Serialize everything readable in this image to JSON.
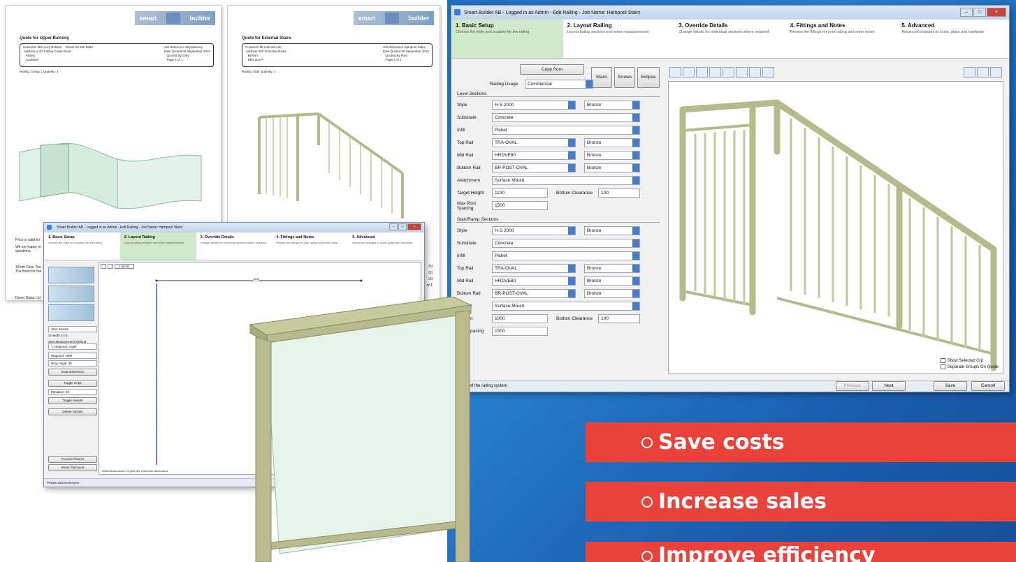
{
  "docs": [
    {
      "logo_left": "smart",
      "logo_right": "builder",
      "title": "Quote for Upper Balcony",
      "cust_col1": "Customer Mrs Lucy Rolston    Phone 09 555 9963\n Address 1-33 Jubilee Creek Road\n   Albany\n   Auckland",
      "cust_col2": "Job Reference Sky Balcony\nDate Quoted 09 September 2010\n   Quoted By Gary\n   Page 1 of 1",
      "meta": "Railing: Group 1     Quantity: 1",
      "price_note": "Price is valid for",
      "happy_note": "We are happy to",
      "questions": "questions.",
      "glass_note": "12mm Clear Tou",
      "finish_note": "The finish for the",
      "footer": "Demo Glass Ltd"
    },
    {
      "logo_left": "smart",
      "logo_right": "builder",
      "title": "Quote for External Stairs",
      "cust_col1": "Customer Mr Harrold Carr\n Address 250 Grenoble Road\n   Brixton\n   BR2 2ULP",
      "cust_col2": "Job Reference Hampool Stairs\nDate Quoted 09 September 2010\n   Quoted By Paul\n   Page 1 of 1",
      "meta": "Railing: Stair     Quantity: 1",
      "r1": ".00",
      "r2": ".00",
      "r3": ".00",
      "r4": "of 1"
    }
  ],
  "main_window": {
    "title": "Smart Builder AB - Logged in as Admin - Edit Railing - Job Name: Hampool Stairs",
    "steps": [
      {
        "head": "1. Basic Setup",
        "desc": "Choose the style and location for the railing"
      },
      {
        "head": "2. Layout Railing",
        "desc": "Layout railing sections and enter measurements"
      },
      {
        "head": "3. Override Details",
        "desc": "Change details for individual sections where required"
      },
      {
        "head": "4. Fittings and Notes",
        "desc": "Review the fittings for your railing and enter notes"
      },
      {
        "head": "5. Advanced",
        "desc": "Advanced changes to costs, glass and hardware"
      }
    ],
    "copy_from": "Copy from",
    "railing_usage_label": "Railing Usage",
    "railing_usage_value": "Commercial",
    "view_buttons": [
      "Stairs",
      "Arrows",
      "Eclipse"
    ],
    "level_section_title": "Level Sections",
    "stair_section_title": "Stair/Ramp Sections",
    "level_rows": [
      {
        "label": "Style",
        "value": "H-S 2000",
        "value2": "Bronze"
      },
      {
        "label": "Substrate",
        "value": "Concrete"
      },
      {
        "label": "Infill",
        "value": "Picket"
      },
      {
        "label": "Top Rail",
        "value": "TRA-OVAL",
        "value2": "Bronze"
      },
      {
        "label": "Mid Rail",
        "value": "HRDVE80",
        "value2": "Bronze"
      },
      {
        "label": "Bottom Rail",
        "value": "BR-POST-OVAL",
        "value2": "Bronze"
      },
      {
        "label": "Attachment",
        "value": "Surface Mount"
      }
    ],
    "target_height_label": "Target Height",
    "target_height_value": "1100",
    "bottom_clearance_label": "Bottom Clearance",
    "bottom_clearance_value": "100",
    "post_spacing_label": "Max Post Spacing",
    "post_spacing_value": "1500",
    "stair_rows": [
      {
        "label": "Style",
        "value": "H-S 2000",
        "value2": "Bronze"
      },
      {
        "label": "Substrate",
        "value": "Concrete"
      },
      {
        "label": "Infill",
        "value": "Picket"
      },
      {
        "label": "Top Rail",
        "value": "TRA-OVAL",
        "value2": "Bronze"
      },
      {
        "label": "Mid Rail",
        "value": "HRDVE80",
        "value2": "Bronze"
      },
      {
        "label": "Bottom Rail",
        "value": "BR-POST-OVAL",
        "value2": "Bronze"
      },
      {
        "label": "chment",
        "value": "Surface Mount"
      }
    ],
    "stair_height_label": "t Height",
    "stair_height_value": "1000",
    "stair_clearance_label": "Bottom Clearance",
    "stair_clearance_value": "100",
    "stair_spacing_label": "Post Spacing",
    "stair_spacing_value": "1500",
    "show_selected_group": "Show Selected Grp",
    "separate_groups": "Separate Groups On Quote",
    "status_text": "location of the railing system",
    "btn_previous": "Previous",
    "btn_next": "Next",
    "btn_save": "Save",
    "btn_cancel": "Cancel"
  },
  "second_window": {
    "title": "Smart Builder AB - Logged in as Admin - Edit Railing - Job Name: Hampool Stairs",
    "steps": [
      {
        "head": "1. Basic Setup",
        "desc": "Choose the style and location for the railing"
      },
      {
        "head": "2. Layout Railing",
        "desc": "Layout railing sections and enter measurements"
      },
      {
        "head": "3. Override Details",
        "desc": "Change details for individual sections where required"
      },
      {
        "head": "4. Fittings and Notes",
        "desc": "Review the fittings for your railing and enter notes"
      },
      {
        "head": "5. Advanced",
        "desc": "Advanced changes to costs, glass and hardware"
      }
    ],
    "layout_label": "Layout",
    "dim_label": "1200",
    "stair_section": "Stair Section",
    "stair_sub": "2x width 4 x 8",
    "method_label": "Stair Measurement Method",
    "method_value": "1. Diagonal, Angle",
    "diagonal": "Diagonal: 1990",
    "drop_angle": "Drop Angle: 35",
    "btn_draw": "Draw Dimension",
    "btn_toggle_grips": "Toggle Grips",
    "elevation": "Elevation: 30",
    "btn_toggle_handle": "Toggle Handle",
    "btn_delete": "Delete Section",
    "btn_preview": "Preview Plan/Jo",
    "btn_reset": "Reset Pty/Guest",
    "footer_note": "Dimensions shown on plan are centreline dimensions",
    "status_text": "Private and Enclosures"
  },
  "banners": [
    "Save costs",
    "Increase sales",
    "Improve efficiency"
  ],
  "colors": {
    "blue_bg": "#1e6fbf",
    "banner_red": "#e8423a",
    "rail_wood": "#b6b98c",
    "glass": "#dff0e6",
    "active_step": "#cfe8c9"
  }
}
